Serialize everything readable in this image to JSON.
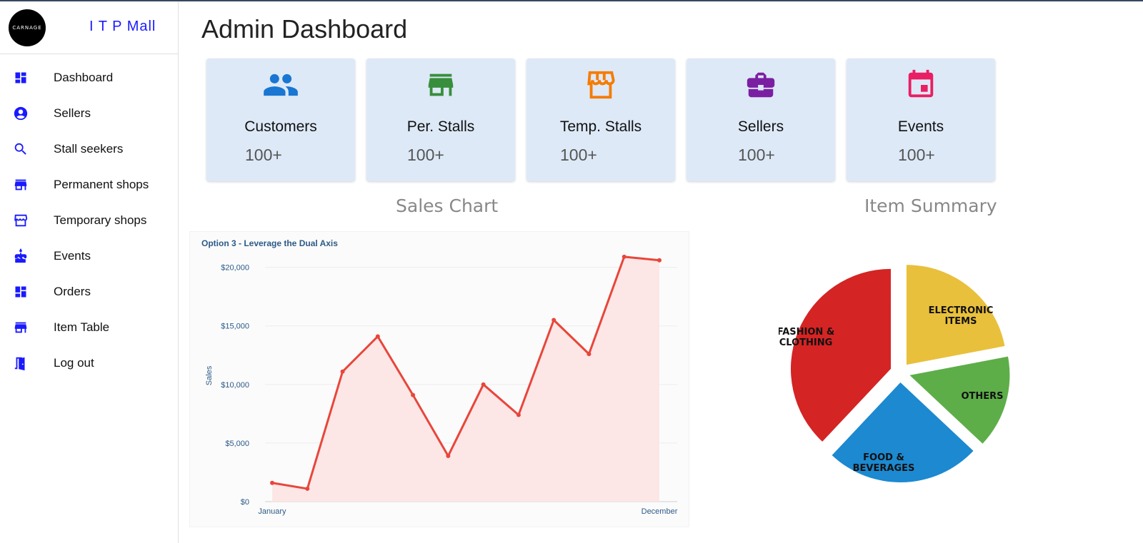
{
  "brand": {
    "logo_text": "CARNAGE",
    "name": "I T P Mall"
  },
  "sidebar": {
    "items": [
      {
        "label": "Dashboard",
        "icon": "dashboard-icon"
      },
      {
        "label": "Sellers",
        "icon": "account-circle-icon"
      },
      {
        "label": "Stall seekers",
        "icon": "search-icon"
      },
      {
        "label": "Permanent shops",
        "icon": "store-icon"
      },
      {
        "label": "Temporary shops",
        "icon": "storefront-icon"
      },
      {
        "label": "Events",
        "icon": "cake-icon"
      },
      {
        "label": "Orders",
        "icon": "dashboard-icon"
      },
      {
        "label": "Item Table",
        "icon": "store-icon"
      },
      {
        "label": "Log out",
        "icon": "door-exit-icon"
      }
    ],
    "icon_color": "#1a1aff"
  },
  "page_title": "Admin Dashboard",
  "cards": [
    {
      "label": "Customers",
      "value": "100+",
      "icon": "people-icon",
      "color": "#1976d2"
    },
    {
      "label": "Per. Stalls",
      "value": "100+",
      "icon": "store-icon",
      "color": "#388e3c"
    },
    {
      "label": "Temp. Stalls",
      "value": "100+",
      "icon": "storefront-icon",
      "color": "#f57c00"
    },
    {
      "label": "Sellers",
      "value": "100+",
      "icon": "briefcase-icon",
      "color": "#7b1fa2"
    },
    {
      "label": "Events",
      "value": "100+",
      "icon": "event-icon",
      "color": "#e91e63"
    }
  ],
  "sections": {
    "sales_title": "Sales Chart",
    "items_title": "Item Summary"
  },
  "chart_data": [
    {
      "type": "area",
      "title": "Option 3 - Leverage the Dual Axis",
      "xlabel": "",
      "ylabel": "Sales",
      "x_tick_labels": [
        "January",
        "December"
      ],
      "y_ticks": [
        0,
        5000,
        10000,
        15000,
        20000
      ],
      "y_tick_labels": [
        "$0",
        "$5,000",
        "$10,000",
        "$15,000",
        "$20,000"
      ],
      "ylim": [
        0,
        21500
      ],
      "grid": true,
      "color": "#e8463b",
      "fill": "#fde6e6",
      "series": [
        {
          "values": [
            1600,
            1100,
            11100,
            14100,
            9100,
            3900,
            10000,
            7400,
            15500,
            12600,
            20900,
            20600
          ]
        }
      ]
    },
    {
      "type": "pie",
      "categories": [
        "ELECTRONIC ITEMS",
        "OTHERS",
        "FOOD & BEVERAGES",
        "FASHION & CLOTHING"
      ],
      "values": [
        22,
        15,
        25,
        38
      ],
      "colors": [
        "#e9c03b",
        "#5dae49",
        "#1c89d0",
        "#d42424"
      ]
    }
  ]
}
